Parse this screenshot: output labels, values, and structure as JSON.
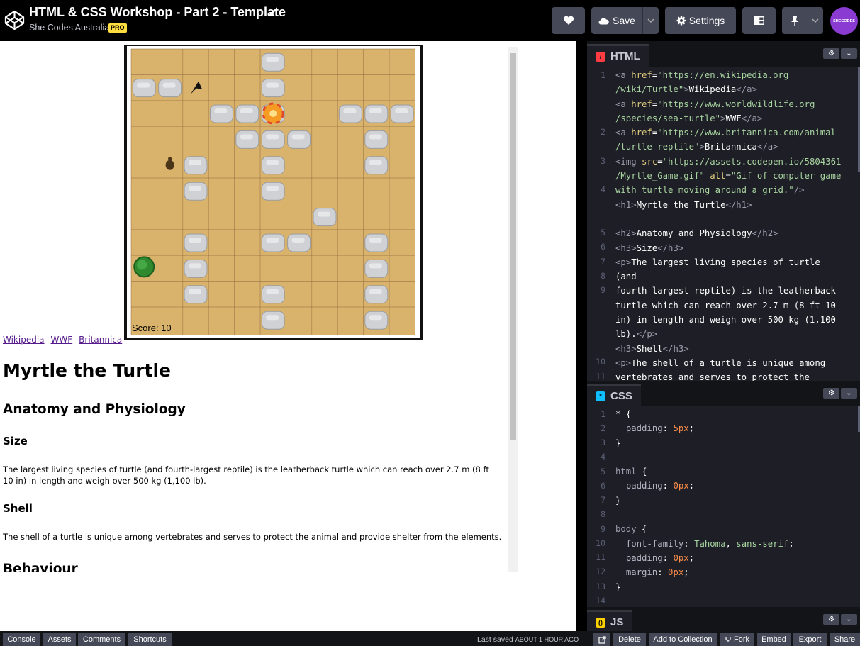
{
  "header": {
    "title": "HTML & CSS Workshop - Part 2 - Template",
    "owner": "She Codes Australia",
    "badge": "PRO",
    "save_label": "Save",
    "settings_label": "Settings",
    "avatar_text": "SHECODES"
  },
  "preview": {
    "game": {
      "score_label": "Score: 10",
      "rocks": [
        [
          5,
          0
        ],
        [
          0,
          1
        ],
        [
          1,
          1
        ],
        [
          5,
          1
        ],
        [
          3,
          2
        ],
        [
          4,
          2
        ],
        [
          5,
          2
        ],
        [
          8,
          2
        ],
        [
          9,
          2
        ],
        [
          10,
          2
        ],
        [
          4,
          3
        ],
        [
          5,
          3
        ],
        [
          6,
          3
        ],
        [
          9,
          3
        ],
        [
          2,
          4
        ],
        [
          5,
          4
        ],
        [
          9,
          4
        ],
        [
          2,
          5
        ],
        [
          5,
          5
        ],
        [
          7,
          6
        ],
        [
          2,
          7
        ],
        [
          5,
          7
        ],
        [
          6,
          7
        ],
        [
          9,
          7
        ],
        [
          2,
          8
        ],
        [
          9,
          8
        ],
        [
          2,
          9
        ],
        [
          5,
          9
        ],
        [
          9,
          9
        ],
        [
          5,
          10
        ],
        [
          9,
          10
        ]
      ],
      "turtle": [
        1,
        4
      ],
      "bird": [
        2,
        1
      ],
      "umbrella": [
        5,
        2
      ],
      "bush": [
        0,
        8
      ]
    },
    "links": [
      "Wikipedia",
      "WWF",
      "Britannica"
    ],
    "h1": "Myrtle the Turtle",
    "h2": "Anatomy and Physiology",
    "h3_size": "Size",
    "p_size": "The largest living species of turtle (and fourth-largest reptile) is the leatherback turtle which can reach over 2.7 m (8 ft 10 in) in length and weigh over 500 kg (1,100 lb).",
    "h3_shell": "Shell",
    "p_shell": "The shell of a turtle is unique among vertebrates and serves to protect the animal and provide shelter from the elements.",
    "h2_behaviour": "Behaviour"
  },
  "editors": {
    "html_label": "HTML",
    "css_label": "CSS",
    "js_label": "JS",
    "html_lines": [
      1,
      2,
      3,
      4,
      5,
      6,
      7,
      8,
      9,
      10,
      11
    ],
    "css_lines": [
      1,
      2,
      3,
      4,
      5,
      6,
      7,
      8,
      9,
      10,
      11,
      12,
      13,
      14
    ]
  },
  "footer": {
    "buttons": [
      "Console",
      "Assets",
      "Comments",
      "Shortcuts"
    ],
    "saved_prefix": "Last saved",
    "saved_time": "ABOUT 1 HOUR AGO",
    "actions": [
      "Delete",
      "Add to Collection",
      "Fork",
      "Embed",
      "Export",
      "Share"
    ]
  },
  "colors": {
    "header_bg": "#000000",
    "button_bg": "#444857",
    "editor_bg": "#1e1f26",
    "pro_badge": "#ffdd40",
    "html_badge": "#ff3c41",
    "css_badge": "#0ebeff",
    "js_badge": "#fcd000",
    "sand": "#d9b36b"
  }
}
